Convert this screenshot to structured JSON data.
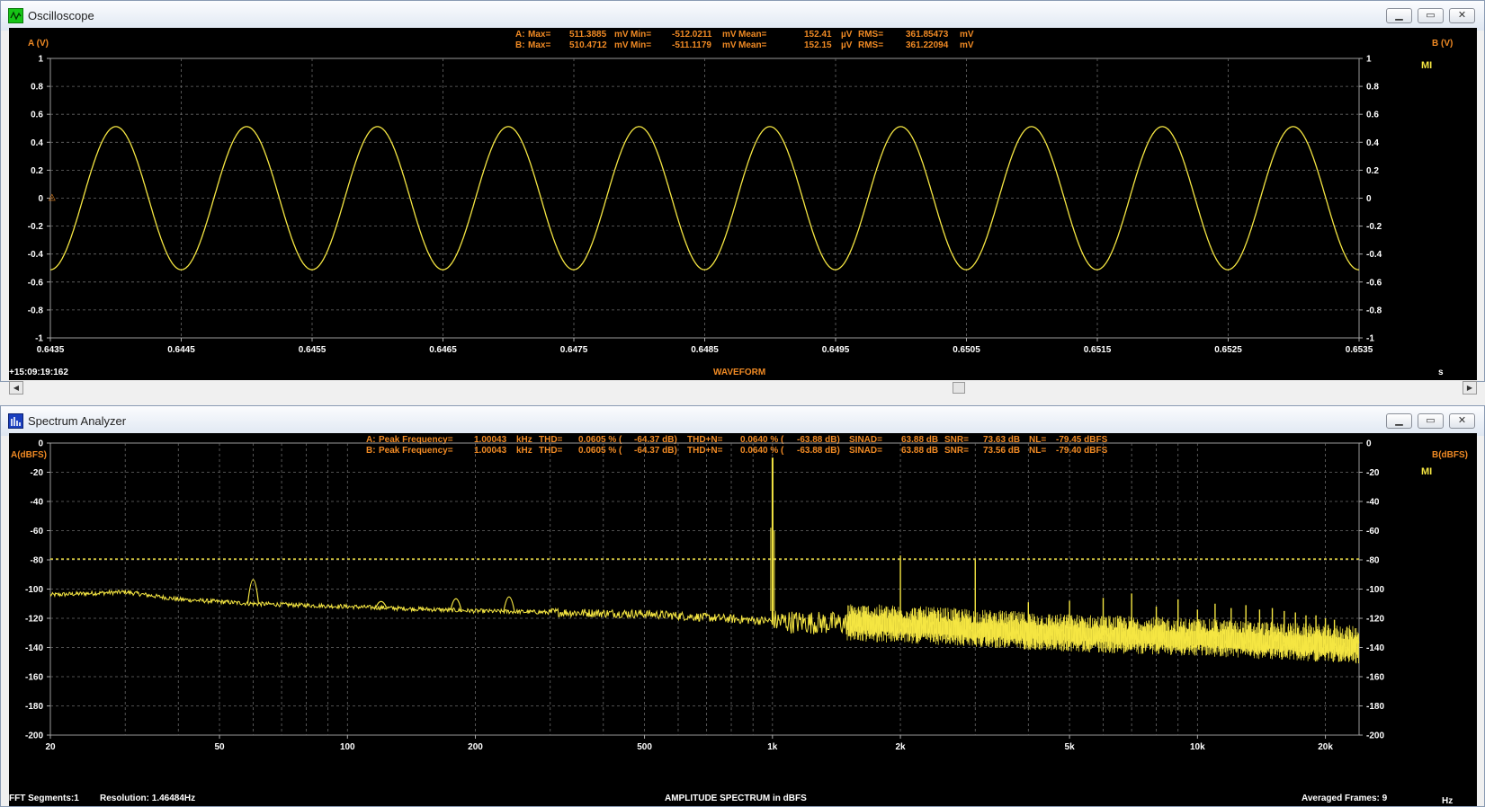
{
  "colors": {
    "trace": "#f5e642",
    "info": "#f08a24",
    "axis": "#ffffff",
    "grid": "#6a6a6a",
    "background": "#000000"
  },
  "oscilloscope": {
    "title": "Oscilloscope",
    "icon": "oscilloscope-icon",
    "controls": {
      "minimize": "▁",
      "restore": "▭",
      "close": "✕"
    },
    "stats": {
      "a": {
        "prefix": "A:",
        "max_label": "Max=",
        "max": "511.3885",
        "min_label": "Min=",
        "min": "-512.0211",
        "mean_label": "Mean=",
        "mean": "152.41",
        "mean_unit": "µV",
        "rms_label": "RMS=",
        "rms": "361.85473",
        "unit": "mV"
      },
      "b": {
        "prefix": "B:",
        "max_label": "Max=",
        "max": "510.4712",
        "min_label": "Min=",
        "min": "-511.1179",
        "mean_label": "Mean=",
        "mean": "152.15",
        "mean_unit": "µV",
        "rms_label": "RMS=",
        "rms": "361.22094",
        "unit": "mV"
      }
    },
    "left_axis_label": "A (V)",
    "right_axis_label": "B (V)",
    "ticks": [
      "1",
      "0.8",
      "0.6",
      "0.4",
      "0.2",
      "0",
      "-0.2",
      "-0.4",
      "-0.6",
      "-0.8",
      "-1"
    ],
    "x_ticks": [
      "0.6435",
      "0.6445",
      "0.6455",
      "0.6465",
      "0.6475",
      "0.6485",
      "0.6495",
      "0.6505",
      "0.6515",
      "0.6525",
      "0.6535"
    ],
    "x_unit": "s",
    "caption": "WAVEFORM",
    "timestamp": "+15:09:19:162",
    "badge": "MI",
    "scroll_left": "◀",
    "scroll_right": "▶"
  },
  "spectrum": {
    "title": "Spectrum Analyzer",
    "icon": "spectrum-analyzer-icon",
    "controls": {
      "minimize": "▁",
      "restore": "▭",
      "close": "✕"
    },
    "stats": {
      "a": {
        "prefix": "A:",
        "pf_label": "Peak Frequency=",
        "pf": "1.00043",
        "pf_unit": "kHz",
        "thd_label": "THD=",
        "thd": "0.0605 % (",
        "thd_db": "-64.37 dB)",
        "thdn_label": "THD+N=",
        "thdn": "0.0640 % (",
        "thdn_db": "-63.88 dB)",
        "sinad_label": "SINAD=",
        "sinad": "63.88 dB",
        "snr_label": "SNR=",
        "snr": "73.63 dB",
        "nl_label": "NL=",
        "nl": "-79.45 dBFS"
      },
      "b": {
        "prefix": "B:",
        "pf_label": "Peak Frequency=",
        "pf": "1.00043",
        "pf_unit": "kHz",
        "thd_label": "THD=",
        "thd": "0.0605 % (",
        "thd_db": "-64.37 dB)",
        "thdn_label": "THD+N=",
        "thdn": "0.0640 % (",
        "thdn_db": "-63.88 dB)",
        "sinad_label": "SINAD=",
        "sinad": "63.88 dB",
        "snr_label": "SNR=",
        "snr": "73.56 dB",
        "nl_label": "NL=",
        "nl": "-79.40 dBFS"
      }
    },
    "left_axis_label": "A(dBFS)",
    "right_axis_label": "B(dBFS)",
    "ticks": [
      "0",
      "-20",
      "-40",
      "-60",
      "-80",
      "-100",
      "-120",
      "-140",
      "-160",
      "-180",
      "-200"
    ],
    "x_ticks": [
      "20",
      "50",
      "100",
      "200",
      "500",
      "1k",
      "2k",
      "5k",
      "10k",
      "20k"
    ],
    "x_unit": "Hz",
    "caption": "AMPLITUDE SPECTRUM in dBFS",
    "fft_segments": "FFT Segments:1",
    "resolution": "Resolution: 1.46484Hz",
    "averaged_frames": "Averaged Frames: 9",
    "badge": "MI"
  },
  "chart_data": [
    {
      "type": "line",
      "caption": "WAVEFORM",
      "xlabel": "s",
      "ylabel": "A (V)",
      "y2label": "B (V)",
      "xlim": [
        0.6435,
        0.6535
      ],
      "ylim": [
        -1,
        1
      ],
      "grid": true,
      "series": [
        {
          "name": "A",
          "function": "sine",
          "amplitude": 0.512,
          "frequency_hz": 1000.43,
          "x_at_first_peak": 0.644
        }
      ]
    },
    {
      "type": "line",
      "caption": "AMPLITUDE SPECTRUM in dBFS",
      "xlabel": "Hz",
      "ylabel": "A(dBFS)",
      "y2label": "B(dBFS)",
      "xscale": "log",
      "xlim": [
        20,
        24000
      ],
      "ylim": [
        -200,
        0
      ],
      "grid": true,
      "noise_level_dbfs": -79.45,
      "fundamental": {
        "x": 1000.43,
        "y": -10
      },
      "harmonics": [
        {
          "x": 2000,
          "y": -77
        },
        {
          "x": 3000,
          "y": -80
        },
        {
          "x": 4000,
          "y": -109
        },
        {
          "x": 5000,
          "y": -108
        },
        {
          "x": 6000,
          "y": -106
        },
        {
          "x": 7000,
          "y": -103
        },
        {
          "x": 8000,
          "y": -112
        },
        {
          "x": 9000,
          "y": -107
        },
        {
          "x": 10000,
          "y": -114
        },
        {
          "x": 11000,
          "y": -110
        },
        {
          "x": 12000,
          "y": -113
        },
        {
          "x": 13000,
          "y": -111
        },
        {
          "x": 14000,
          "y": -114
        },
        {
          "x": 15000,
          "y": -113
        },
        {
          "x": 16000,
          "y": -115
        },
        {
          "x": 17000,
          "y": -116
        },
        {
          "x": 18000,
          "y": -118
        },
        {
          "x": 19000,
          "y": -118
        },
        {
          "x": 20000,
          "y": -120
        },
        {
          "x": 21000,
          "y": -121
        }
      ],
      "spurs": [
        {
          "x": 60,
          "y": -88
        },
        {
          "x": 120,
          "y": -107
        },
        {
          "x": 180,
          "y": -104
        },
        {
          "x": 240,
          "y": -102
        }
      ],
      "noise_floor": [
        {
          "x": 20,
          "y": -104
        },
        {
          "x": 30,
          "y": -102
        },
        {
          "x": 40,
          "y": -107
        },
        {
          "x": 60,
          "y": -110
        },
        {
          "x": 100,
          "y": -112
        },
        {
          "x": 200,
          "y": -115
        },
        {
          "x": 500,
          "y": -117
        },
        {
          "x": 1000,
          "y": -122
        },
        {
          "x": 2000,
          "y": -125
        },
        {
          "x": 5000,
          "y": -131
        },
        {
          "x": 10000,
          "y": -134
        },
        {
          "x": 24000,
          "y": -139
        }
      ]
    }
  ]
}
